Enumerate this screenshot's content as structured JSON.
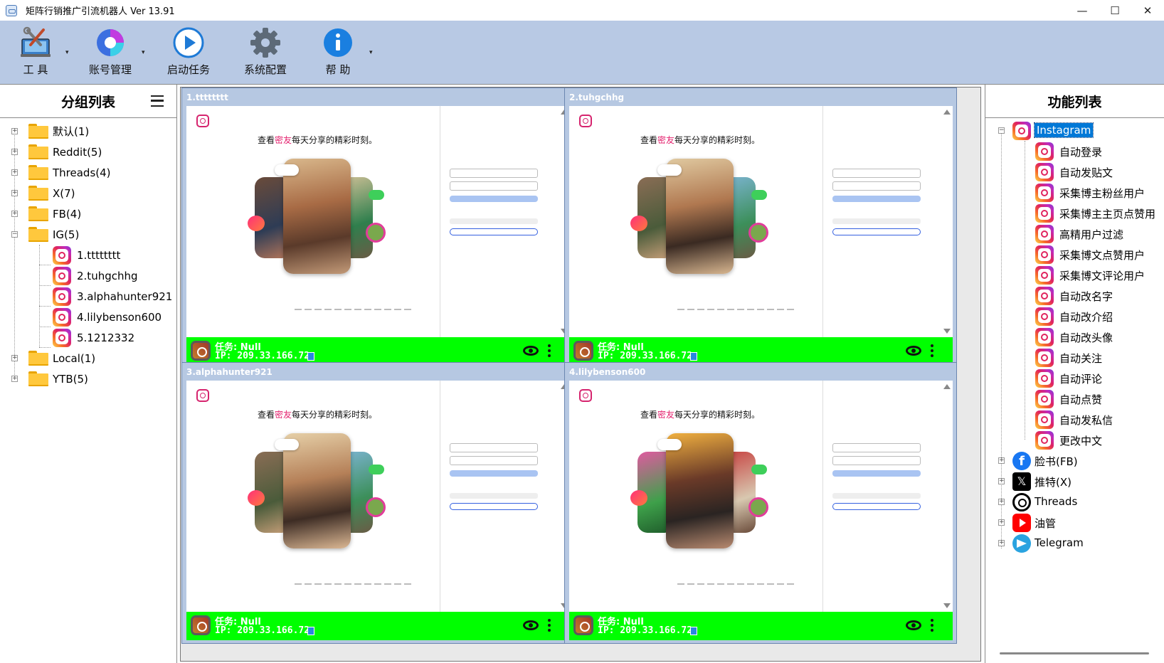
{
  "window": {
    "title": "矩阵行销推广引流机器人 Ver 13.91",
    "controls": {
      "minimize": "—",
      "maximize": "☐",
      "close": "✕"
    }
  },
  "toolbar": {
    "items": [
      {
        "label": "工  具",
        "icon": "tools-icon",
        "has_dropdown": true
      },
      {
        "label": "账号管理",
        "icon": "account-icon",
        "has_dropdown": true
      },
      {
        "label": "启动任务",
        "icon": "play-icon",
        "has_dropdown": false
      },
      {
        "label": "系统配置",
        "icon": "gear-icon",
        "has_dropdown": false
      },
      {
        "label": "帮  助",
        "icon": "info-icon",
        "has_dropdown": true
      }
    ]
  },
  "left_panel": {
    "title": "分组列表",
    "groups": [
      {
        "label": "默认(1)",
        "expanded": false
      },
      {
        "label": "Reddit(5)",
        "expanded": false
      },
      {
        "label": "Threads(4)",
        "expanded": false
      },
      {
        "label": "X(7)",
        "expanded": false
      },
      {
        "label": "FB(4)",
        "expanded": false
      },
      {
        "label": "IG(5)",
        "expanded": true
      },
      {
        "label": "Local(1)",
        "expanded": false
      },
      {
        "label": "YTB(5)",
        "expanded": false
      }
    ],
    "ig_accounts": [
      "1.tttttttt",
      "2.tuhgchhg",
      "3.alphahunter921",
      "4.lilybenson600",
      "5.1212332"
    ]
  },
  "browsers": [
    {
      "title": "1.tttttttt",
      "headline_pre": "查看",
      "headline_pink": "密友",
      "headline_post": "每天分享的精彩时刻。",
      "task": "任务:  Null",
      "ip": "IP: 209.33.166.72"
    },
    {
      "title": "2.tuhgchhg",
      "headline_pre": "查看",
      "headline_pink": "密友",
      "headline_post": "每天分享的精彩时刻。",
      "task": "任务:  Null",
      "ip": "IP: 209.33.166.72"
    },
    {
      "title": "3.alphahunter921",
      "headline_pre": "查看",
      "headline_pink": "密友",
      "headline_post": "每天分享的精彩时刻。",
      "task": "任务:  Null",
      "ip": "IP: 209.33.166.72"
    },
    {
      "title": "4.lilybenson600",
      "headline_pre": "查看",
      "headline_pink": "密友",
      "headline_post": "每天分享的精彩时刻。",
      "task": "任务:  Null",
      "ip": "IP: 209.33.166.72"
    }
  ],
  "right_panel": {
    "title": "功能列表",
    "root": "Instagram",
    "ig_functions": [
      "自动登录",
      "自动发贴文",
      "采集博主粉丝用户",
      "采集博主主页点赞用",
      "高精用户过滤",
      "采集博文点赞用户",
      "采集博文评论用户",
      "自动改名字",
      "自动改介绍",
      "自动改头像",
      "自动关注",
      "自动评论",
      "自动点赞",
      "自动发私信",
      "更改中文"
    ],
    "platforms": [
      {
        "label": "脸书(FB)",
        "icon": "facebook-icon"
      },
      {
        "label": "推特(X)",
        "icon": "x-icon"
      },
      {
        "label": "Threads",
        "icon": "threads-icon"
      },
      {
        "label": "油管",
        "icon": "youtube-icon"
      },
      {
        "label": "Telegram",
        "icon": "telegram-icon"
      }
    ]
  },
  "colors": {
    "toolbar_bg": "#b8c9e4",
    "status_green": "#00ff00",
    "selection_blue": "#0078d7",
    "headline_pink": "#e4216e"
  }
}
